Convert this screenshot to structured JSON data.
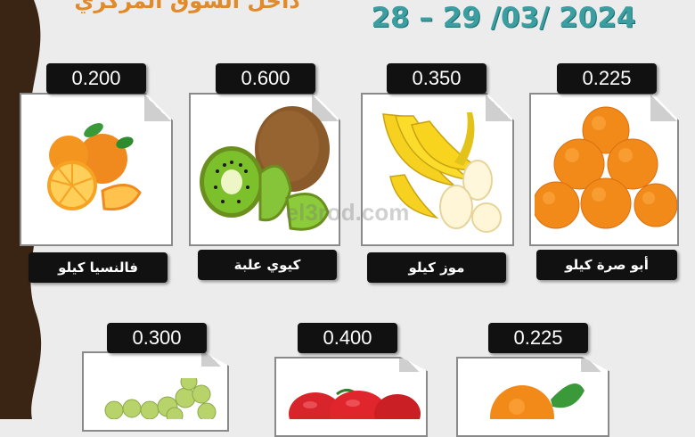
{
  "header": {
    "title": "داخل السوق المركزي",
    "date": "28 – 29 /03/ 2024"
  },
  "watermark": "el3rod.com",
  "products": [
    {
      "price": "0.200",
      "label": "فالنسيا كيلو",
      "icon": "orange-valencia-icon"
    },
    {
      "price": "0.600",
      "label": "كيوي علبة",
      "icon": "kiwi-icon"
    },
    {
      "price": "0.350",
      "label": "موز كيلو",
      "icon": "banana-icon"
    },
    {
      "price": "0.225",
      "label": "أبو صرة كيلو",
      "icon": "navel-orange-icon"
    },
    {
      "price": "0.300",
      "label": "",
      "icon": "grapes-icon"
    },
    {
      "price": "0.400",
      "label": "",
      "icon": "apple-icon"
    },
    {
      "price": "0.225",
      "label": "",
      "icon": "orange-leaf-icon"
    }
  ],
  "colors": {
    "background": "#ececec",
    "date": "#3b9ea0",
    "title": "#e08a2c",
    "tag": "#111111",
    "wave": "#3a2414"
  }
}
